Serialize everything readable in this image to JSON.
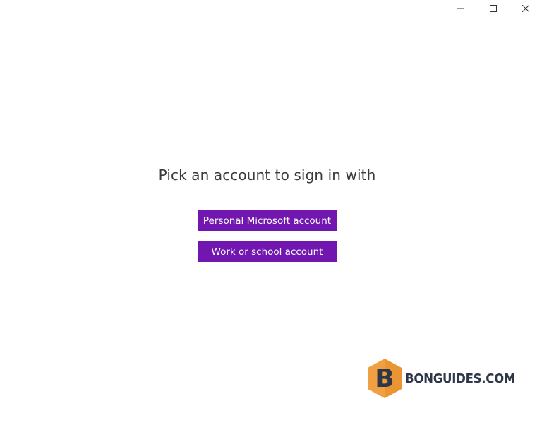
{
  "window": {
    "caption": {
      "minimize_icon": "minimize-icon",
      "maximize_icon": "maximize-icon",
      "close_icon": "close-icon"
    }
  },
  "main": {
    "heading": "Pick an account to sign in with",
    "buttons": {
      "personal": "Personal Microsoft account",
      "work": "Work or school account"
    }
  },
  "watermark": {
    "logo_letter": "B",
    "text": "BONGUIDES.COM"
  },
  "colors": {
    "accent": "#7216b0",
    "background": "#ffffff",
    "heading_text": "#3a3a3a",
    "logo_orange": "#f0a042",
    "logo_dark": "#2e3748"
  }
}
